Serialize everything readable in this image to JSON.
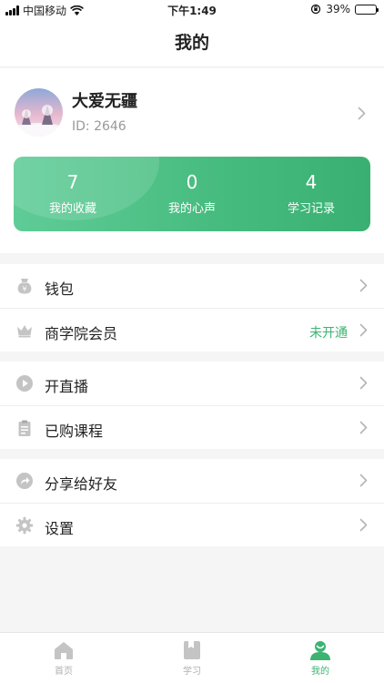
{
  "status_bar": {
    "carrier": "中国移动",
    "time": "下午1:49",
    "battery_text": "39%",
    "battery_level": 0.39
  },
  "nav": {
    "title": "我的"
  },
  "profile": {
    "name": "大爱无疆",
    "id_text": "ID: 2646"
  },
  "stats": [
    {
      "value": "7",
      "label": "我的收藏"
    },
    {
      "value": "0",
      "label": "我的心声"
    },
    {
      "value": "4",
      "label": "学习记录"
    }
  ],
  "menu": {
    "wallet": {
      "label": "钱包",
      "icon": "wallet-icon"
    },
    "membership": {
      "label": "商学院会员",
      "status": "未开通",
      "icon": "crown-icon"
    },
    "live": {
      "label": "开直播",
      "icon": "play-icon"
    },
    "courses": {
      "label": "已购课程",
      "icon": "clipboard-icon"
    },
    "share": {
      "label": "分享给好友",
      "icon": "share-icon"
    },
    "settings": {
      "label": "设置",
      "icon": "gear-icon"
    }
  },
  "tabs": [
    {
      "label": "首页",
      "icon": "home-icon",
      "active": false
    },
    {
      "label": "学习",
      "icon": "book-icon",
      "active": false
    },
    {
      "label": "我的",
      "icon": "user-icon",
      "active": true
    }
  ],
  "colors": {
    "accent": "#3cb371",
    "stats_gradient_start": "#5fcc97",
    "stats_gradient_end": "#39b072",
    "icon_gray": "#c4c4c4"
  }
}
